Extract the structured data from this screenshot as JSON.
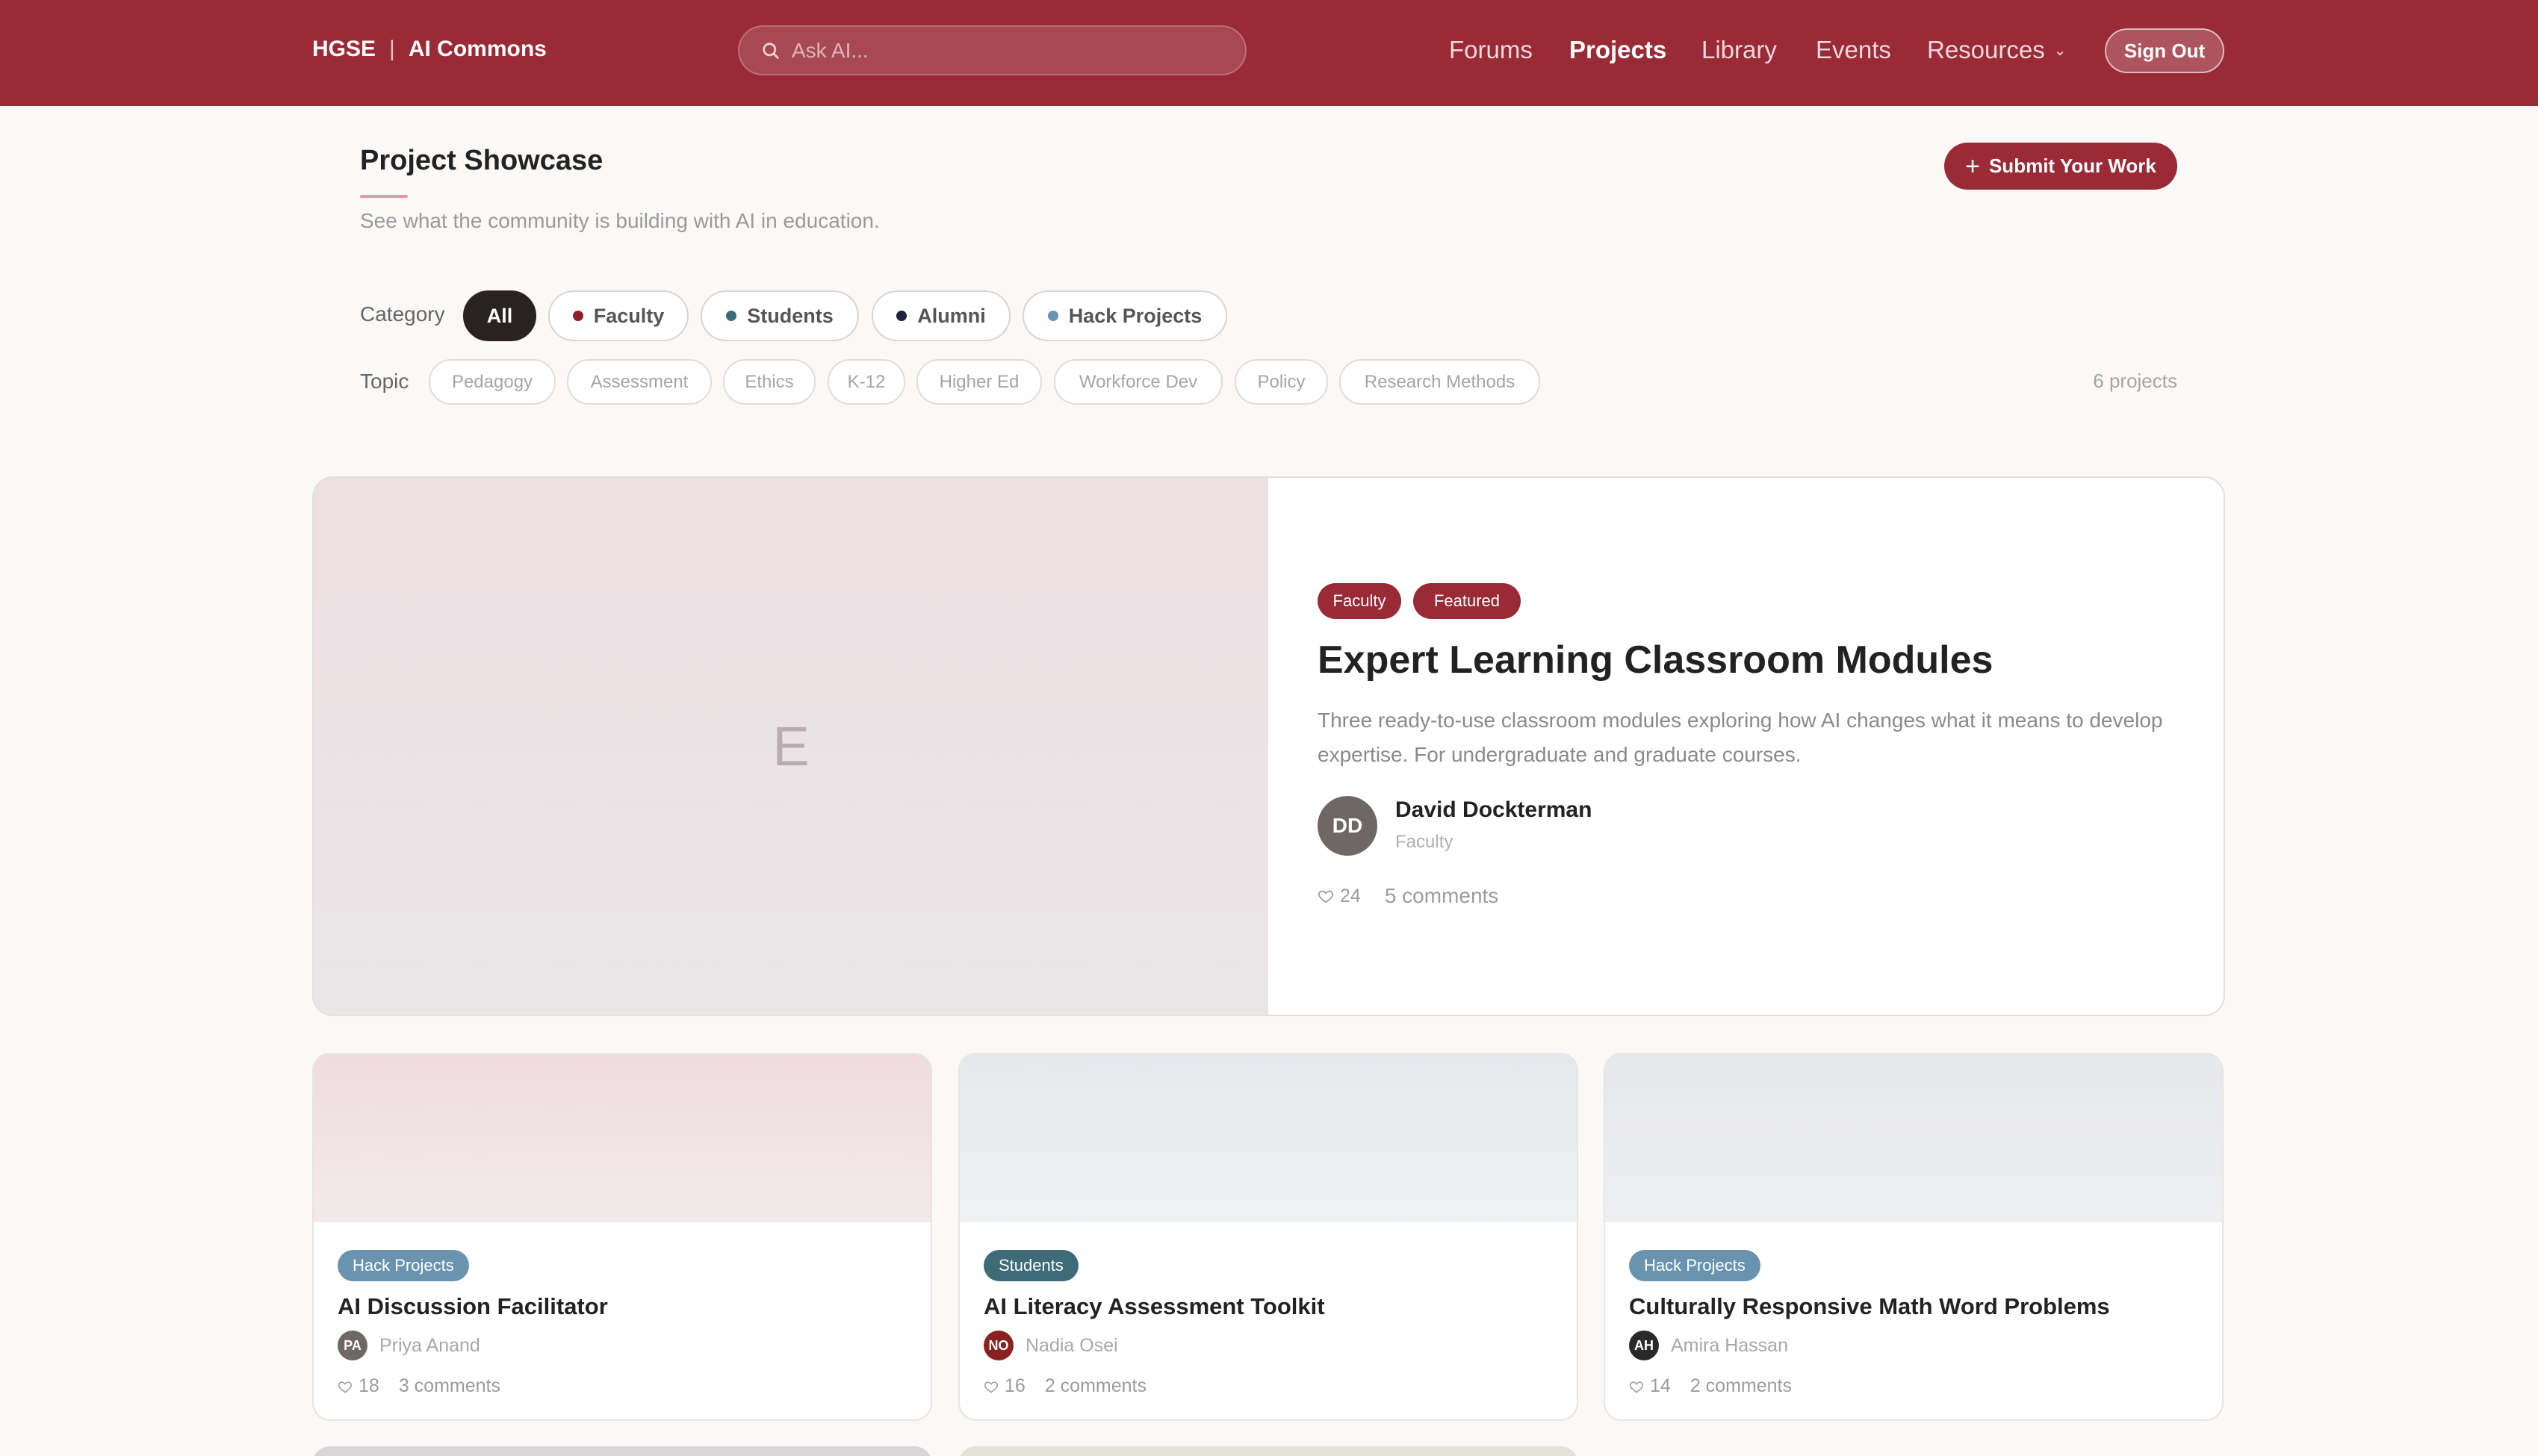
{
  "header": {
    "brand_primary": "HGSE",
    "brand_separator": "|",
    "brand_secondary": "AI Commons",
    "search_placeholder": "Ask AI...",
    "nav": [
      "Forums",
      "Projects",
      "Library",
      "Events",
      "Resources"
    ],
    "active_nav": "Projects",
    "sign_out_label": "Sign Out"
  },
  "page": {
    "title": "Project Showcase",
    "subtitle": "See what the community is building with AI in education.",
    "submit_label": "Submit Your Work"
  },
  "filters": {
    "category_label": "Category",
    "categories": [
      {
        "label": "All",
        "active": true
      },
      {
        "label": "Faculty",
        "dot": "#8c1f2b"
      },
      {
        "label": "Students",
        "dot": "#3e6b78"
      },
      {
        "label": "Alumni",
        "dot": "#1f2438"
      },
      {
        "label": "Hack Projects",
        "dot": "#6a93b0"
      }
    ],
    "topic_label": "Topic",
    "topics": [
      "Pedagogy",
      "Assessment",
      "Ethics",
      "K-12",
      "Higher Ed",
      "Workforce Dev",
      "Policy",
      "Research Methods"
    ],
    "count_text": "6 projects"
  },
  "featured": {
    "image_letter": "E",
    "badges": [
      "Faculty",
      "Featured"
    ],
    "title": "Expert Learning Classroom Modules",
    "description": "Three ready-to-use classroom modules exploring how AI changes what it means to develop expertise. For undergraduate and graduate courses.",
    "author_initials": "DD",
    "author_name": "David Dockterman",
    "author_role": "Faculty",
    "likes": "24",
    "comments": "5 comments"
  },
  "cards": [
    {
      "badge": "Hack Projects",
      "title": "AI Discussion Facilitator",
      "initials": "PA",
      "author": "Priya Anand",
      "likes": "18",
      "comments": "3 comments"
    },
    {
      "badge": "Students",
      "title": "AI Literacy Assessment Toolkit",
      "initials": "NO",
      "author": "Nadia Osei",
      "likes": "16",
      "comments": "2 comments"
    },
    {
      "badge": "Hack Projects",
      "title": "Culturally Responsive Math Word Problems",
      "initials": "AH",
      "author": "Amira Hassan",
      "likes": "14",
      "comments": "2 comments"
    }
  ],
  "colors": {
    "brand": "#9a2a36",
    "faculty_badge": "#9a2a36",
    "featured_badge": "#9a2a36",
    "students_badge": "#3e6b78",
    "hack_badge": "#6a93b0"
  }
}
